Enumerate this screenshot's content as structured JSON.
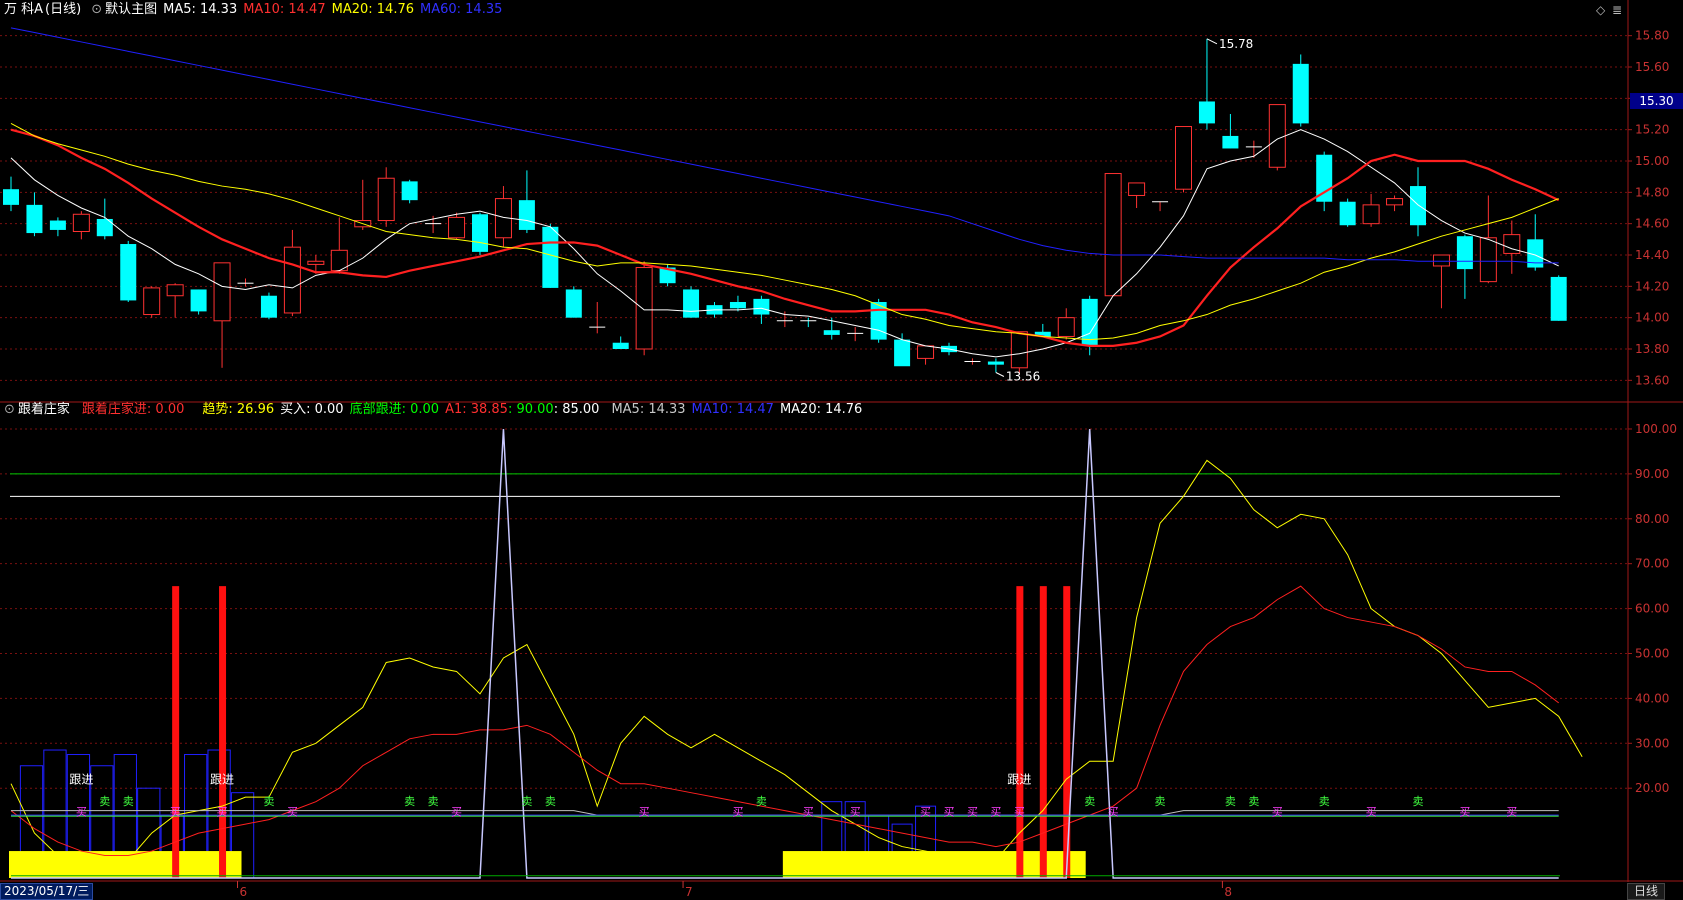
{
  "top_header": {
    "stock_name": "万 科A",
    "period": "(日线)",
    "template": "默认主图",
    "ma5": "MA5: 14.33",
    "ma10": "MA10: 14.47",
    "ma20": "MA20: 14.76",
    "ma60": "MA60: 14.35"
  },
  "bottom_header": {
    "indicator": "跟着庄家",
    "follow_dealer": "跟着庄家进: 0.00",
    "trend": "趋势: 26.96",
    "buy_in": "买入: 0.00",
    "bottom_follow": "底部跟进: 0.00",
    "a1": "A1: 38.85",
    "v90": ": 90.00",
    "v85": ": 85.00",
    "ma5": "MA5: 14.33",
    "ma10": "MA10: 14.47",
    "ma20": "MA20: 14.76"
  },
  "current_price": "15.30",
  "high_label": "15.78",
  "low_label": "13.56",
  "footer": {
    "date": "2023/05/17/三",
    "months": [
      "6",
      "7",
      "8"
    ],
    "period_tab": "日线"
  },
  "colors": {
    "up": "#ff3232",
    "down": "#00ffff",
    "ma5": "#ffffff",
    "ma10": "#ff2020",
    "ma20": "#ffff00",
    "ma60": "#2020ff",
    "grid": "#7a1010"
  },
  "chart_data": [
    {
      "type": "candlestick",
      "ylim": [
        13.5,
        15.9
      ],
      "y_ticks": [
        13.6,
        13.8,
        14.0,
        14.2,
        14.4,
        14.6,
        14.8,
        15.0,
        15.2,
        15.4,
        15.6,
        15.8
      ],
      "candles": [
        [
          14.82,
          14.9,
          14.68,
          14.72
        ],
        [
          14.72,
          14.8,
          14.52,
          14.54
        ],
        [
          14.62,
          14.64,
          14.52,
          14.56
        ],
        [
          14.55,
          14.68,
          14.5,
          14.66
        ],
        [
          14.63,
          14.76,
          14.5,
          14.52
        ],
        [
          14.47,
          14.49,
          14.1,
          14.11
        ],
        [
          14.02,
          14.2,
          14.0,
          14.19
        ],
        [
          14.14,
          14.22,
          14.0,
          14.21
        ],
        [
          14.18,
          14.18,
          14.02,
          14.04
        ],
        [
          13.98,
          14.34,
          13.68,
          14.35
        ],
        [
          14.21,
          14.25,
          14.2,
          14.22
        ],
        [
          14.14,
          14.16,
          13.99,
          14.0
        ],
        [
          14.03,
          14.56,
          14.01,
          14.45
        ],
        [
          14.34,
          14.4,
          14.28,
          14.36
        ],
        [
          14.3,
          14.64,
          14.28,
          14.43
        ],
        [
          14.58,
          14.88,
          14.56,
          14.62
        ],
        [
          14.62,
          14.96,
          14.58,
          14.89
        ],
        [
          14.87,
          14.88,
          14.73,
          14.75
        ],
        [
          14.6,
          14.65,
          14.54,
          14.6
        ],
        [
          14.51,
          14.67,
          14.5,
          14.64
        ],
        [
          14.66,
          14.67,
          14.4,
          14.42
        ],
        [
          14.51,
          14.84,
          14.45,
          14.76
        ],
        [
          14.75,
          14.94,
          14.54,
          14.56
        ],
        [
          14.58,
          14.6,
          14.19,
          14.19
        ],
        [
          14.18,
          14.2,
          14.0,
          14.0
        ],
        [
          13.93,
          14.1,
          13.9,
          13.94
        ],
        [
          13.84,
          13.88,
          13.8,
          13.8
        ],
        [
          13.8,
          14.36,
          13.76,
          14.32
        ],
        [
          14.32,
          14.34,
          14.2,
          14.22
        ],
        [
          14.18,
          14.2,
          14.0,
          14.0
        ],
        [
          14.08,
          14.1,
          14.0,
          14.02
        ],
        [
          14.1,
          14.14,
          14.04,
          14.06
        ],
        [
          14.12,
          14.14,
          13.96,
          14.02
        ],
        [
          13.97,
          14.04,
          13.94,
          13.98
        ],
        [
          13.98,
          14.0,
          13.94,
          13.97
        ],
        [
          13.92,
          14.0,
          13.86,
          13.89
        ],
        [
          13.9,
          13.94,
          13.85,
          13.9
        ],
        [
          14.1,
          14.12,
          13.84,
          13.86
        ],
        [
          13.86,
          13.9,
          13.7,
          13.69
        ],
        [
          13.74,
          13.82,
          13.7,
          13.82
        ],
        [
          13.82,
          13.84,
          13.76,
          13.78
        ],
        [
          13.72,
          13.74,
          13.7,
          13.72
        ],
        [
          13.72,
          13.74,
          13.65,
          13.7
        ],
        [
          13.68,
          13.9,
          13.64,
          13.91
        ],
        [
          13.91,
          13.96,
          13.88,
          13.88
        ],
        [
          13.88,
          14.06,
          13.86,
          14.0
        ],
        [
          14.12,
          14.14,
          13.76,
          13.82
        ],
        [
          14.14,
          14.92,
          14.14,
          14.92
        ],
        [
          14.78,
          14.86,
          14.7,
          14.86
        ],
        [
          14.74,
          14.74,
          14.68,
          14.74
        ],
        [
          14.82,
          15.22,
          14.8,
          15.22
        ],
        [
          15.38,
          15.78,
          15.2,
          15.24
        ],
        [
          15.16,
          15.3,
          15.08,
          15.08
        ],
        [
          15.09,
          15.13,
          15.02,
          15.09
        ],
        [
          14.96,
          15.36,
          14.94,
          15.36
        ],
        [
          15.62,
          15.68,
          15.22,
          15.24
        ],
        [
          15.04,
          15.06,
          14.68,
          14.74
        ],
        [
          14.74,
          14.76,
          14.58,
          14.59
        ],
        [
          14.6,
          14.79,
          14.58,
          14.72
        ],
        [
          14.72,
          14.78,
          14.68,
          14.76
        ],
        [
          14.84,
          14.96,
          14.52,
          14.59
        ],
        [
          14.33,
          14.38,
          14.06,
          14.4
        ],
        [
          14.52,
          14.53,
          14.12,
          14.31
        ],
        [
          14.23,
          14.78,
          14.22,
          14.51
        ],
        [
          14.41,
          14.62,
          14.28,
          14.53
        ],
        [
          14.5,
          14.66,
          14.3,
          14.32
        ],
        [
          14.26,
          14.27,
          13.98,
          13.98
        ]
      ],
      "series": [
        {
          "name": "MA5",
          "values": [
            15.02,
            14.88,
            14.78,
            14.7,
            14.64,
            14.52,
            14.44,
            14.34,
            14.28,
            14.2,
            14.18,
            14.21,
            14.19,
            14.27,
            14.3,
            14.38,
            14.5,
            14.6,
            14.63,
            14.66,
            14.68,
            14.64,
            14.62,
            14.58,
            14.44,
            14.28,
            14.17,
            14.05,
            14.05,
            14.04,
            14.05,
            14.05,
            14.06,
            14.02,
            14.01,
            13.98,
            13.95,
            13.92,
            13.86,
            13.82,
            13.8,
            13.77,
            13.75,
            13.77,
            13.8,
            13.84,
            13.9,
            14.14,
            14.28,
            14.45,
            14.65,
            14.95,
            15.0,
            15.03,
            15.14,
            15.2,
            15.14,
            15.06,
            14.96,
            14.86,
            14.72,
            14.62,
            14.54,
            14.5,
            14.44,
            14.4,
            14.33
          ]
        },
        {
          "name": "MA10",
          "values": [
            15.2,
            15.16,
            15.1,
            15.02,
            14.95,
            14.86,
            14.76,
            14.67,
            14.58,
            14.5,
            14.44,
            14.38,
            14.34,
            14.29,
            14.29,
            14.27,
            14.26,
            14.3,
            14.33,
            14.36,
            14.39,
            14.43,
            14.47,
            14.48,
            14.48,
            14.46,
            14.4,
            14.34,
            14.31,
            14.28,
            14.24,
            14.2,
            14.17,
            14.12,
            14.08,
            14.04,
            14.04,
            14.05,
            14.05,
            14.05,
            14.02,
            13.97,
            13.94,
            13.9,
            13.88,
            13.84,
            13.82,
            13.82,
            13.84,
            13.88,
            13.95,
            14.14,
            14.32,
            14.45,
            14.57,
            14.71,
            14.8,
            14.89,
            15.0,
            15.04,
            15.0,
            15.0,
            15.0,
            14.95,
            14.88,
            14.82,
            14.75
          ]
        },
        {
          "name": "MA20",
          "values": [
            15.24,
            15.16,
            15.11,
            15.07,
            15.03,
            14.98,
            14.94,
            14.91,
            14.87,
            14.84,
            14.82,
            14.79,
            14.75,
            14.7,
            14.65,
            14.6,
            14.55,
            14.53,
            14.51,
            14.5,
            14.48,
            14.45,
            14.44,
            14.4,
            14.36,
            14.33,
            14.35,
            14.35,
            14.34,
            14.33,
            14.31,
            14.29,
            14.27,
            14.24,
            14.21,
            14.18,
            14.14,
            14.08,
            14.02,
            13.99,
            13.95,
            13.93,
            13.91,
            13.9,
            13.88,
            13.87,
            13.86,
            13.87,
            13.9,
            13.95,
            13.98,
            14.02,
            14.08,
            14.12,
            14.17,
            14.22,
            14.29,
            14.33,
            14.38,
            14.42,
            14.47,
            14.52,
            14.56,
            14.6,
            14.64,
            14.7,
            14.76
          ]
        },
        {
          "name": "MA60",
          "values": [
            15.85,
            15.82,
            15.79,
            15.76,
            15.73,
            15.7,
            15.67,
            15.64,
            15.61,
            15.58,
            15.55,
            15.52,
            15.49,
            15.46,
            15.43,
            15.4,
            15.37,
            15.34,
            15.31,
            15.28,
            15.25,
            15.22,
            15.19,
            15.16,
            15.13,
            15.1,
            15.07,
            15.04,
            15.01,
            14.98,
            14.95,
            14.92,
            14.89,
            14.86,
            14.83,
            14.8,
            14.77,
            14.74,
            14.71,
            14.68,
            14.65,
            14.6,
            14.55,
            14.5,
            14.46,
            14.43,
            14.41,
            14.4,
            14.4,
            14.4,
            14.39,
            14.38,
            14.38,
            14.38,
            14.38,
            14.38,
            14.38,
            14.37,
            14.37,
            14.37,
            14.36,
            14.36,
            14.36,
            14.36,
            14.36,
            14.35,
            14.35
          ]
        }
      ]
    },
    {
      "type": "line",
      "ylim": [
        0,
        102
      ],
      "y_ticks": [
        20,
        30,
        40,
        50,
        60,
        70,
        80,
        90,
        100
      ],
      "reference_lines": [
        90,
        85
      ],
      "series": [
        {
          "name": "趋势",
          "values": [
            21,
            10,
            5,
            3,
            2,
            4,
            10,
            14,
            15,
            16,
            18,
            18,
            28,
            30,
            34,
            38,
            48,
            49,
            47,
            46,
            41,
            49,
            52,
            42,
            32,
            16,
            30,
            36,
            32,
            29,
            32,
            29,
            26,
            23,
            19,
            15,
            12,
            9,
            7,
            6,
            5,
            4,
            4,
            10,
            15,
            22,
            26,
            26,
            58,
            79,
            85,
            93,
            89,
            82,
            78,
            81,
            80,
            72,
            60,
            56,
            54,
            50,
            44,
            38,
            39,
            40,
            36,
            27
          ]
        },
        {
          "name": "A1",
          "values": [
            15,
            11,
            8,
            6,
            5,
            5,
            6,
            8,
            10,
            11,
            12,
            13,
            15,
            17,
            20,
            25,
            28,
            31,
            32,
            32,
            33,
            33,
            34,
            32,
            28,
            24,
            21,
            21,
            20,
            19,
            18,
            17,
            16,
            15,
            14,
            13,
            12,
            11,
            10,
            9,
            8,
            8,
            7,
            8,
            10,
            12,
            14,
            16,
            20,
            34,
            46,
            52,
            56,
            58,
            62,
            65,
            60,
            58,
            57,
            56,
            54,
            51,
            47,
            46,
            46,
            43,
            39
          ]
        },
        {
          "name": "MA5",
          "values": [
            15,
            15,
            15,
            15,
            15,
            15,
            15,
            15,
            15,
            15,
            15,
            15,
            15,
            15,
            15,
            15,
            15,
            15,
            15,
            15,
            15,
            15,
            15,
            15,
            15,
            14,
            14,
            14,
            14,
            14,
            14,
            14,
            14,
            14,
            14,
            14,
            14,
            14,
            14,
            14,
            14,
            14,
            14,
            14,
            14,
            14,
            14,
            14,
            14,
            14,
            15,
            15,
            15,
            15,
            15,
            15,
            15,
            15,
            15,
            15,
            15,
            15,
            15,
            15,
            15,
            15,
            15
          ]
        },
        {
          "name": "MA10",
          "values": [
            14,
            14,
            14,
            14,
            14,
            14,
            14,
            14,
            14,
            14,
            14,
            14,
            14,
            14,
            14,
            14,
            14,
            14,
            14,
            14,
            14,
            14,
            14,
            14,
            14,
            14,
            14,
            14,
            14,
            14,
            14,
            14,
            14,
            14,
            14,
            14,
            14,
            14,
            14,
            14,
            14,
            14,
            14,
            14,
            14,
            14,
            14,
            14,
            14,
            14,
            14,
            14,
            14,
            14,
            14,
            14,
            14,
            14,
            14,
            14,
            14,
            14,
            14,
            14,
            14,
            14,
            14
          ]
        },
        {
          "name": "底部跟进",
          "values": [
            0,
            0,
            0,
            0,
            0,
            0,
            0,
            0,
            0,
            0,
            0,
            0,
            0,
            0,
            0,
            0,
            0,
            0,
            0,
            0,
            0,
            100,
            0,
            0,
            0,
            0,
            0,
            0,
            0,
            0,
            0,
            0,
            0,
            0,
            0,
            0,
            0,
            0,
            0,
            0,
            0,
            0,
            0,
            0,
            0,
            0,
            100,
            0,
            0,
            0,
            0,
            0,
            0,
            0,
            0,
            0,
            0,
            0,
            0,
            0,
            0,
            0,
            0,
            0,
            0,
            0,
            0
          ]
        }
      ],
      "signal_bars": [
        7,
        9,
        43,
        44,
        45
      ],
      "signal_bar_top": 65,
      "yellow_blocks": [
        [
          0,
          10
        ],
        [
          33,
          46
        ]
      ],
      "follow_labels": [
        {
          "text": "跟进",
          "index": 3
        },
        {
          "text": "跟进",
          "index": 9
        },
        {
          "text": "跟进",
          "index": 43
        }
      ],
      "marker_labels": {
        "buy": "买",
        "sell": "卖"
      },
      "buy_markers": [
        3,
        7,
        9,
        12,
        19,
        27,
        31,
        34,
        36,
        39,
        40,
        41,
        42,
        43,
        47,
        54,
        58,
        62,
        64
      ],
      "sell_markers": [
        4,
        5,
        11,
        17,
        18,
        22,
        23,
        32,
        46,
        49,
        52,
        53,
        56,
        60
      ]
    }
  ]
}
